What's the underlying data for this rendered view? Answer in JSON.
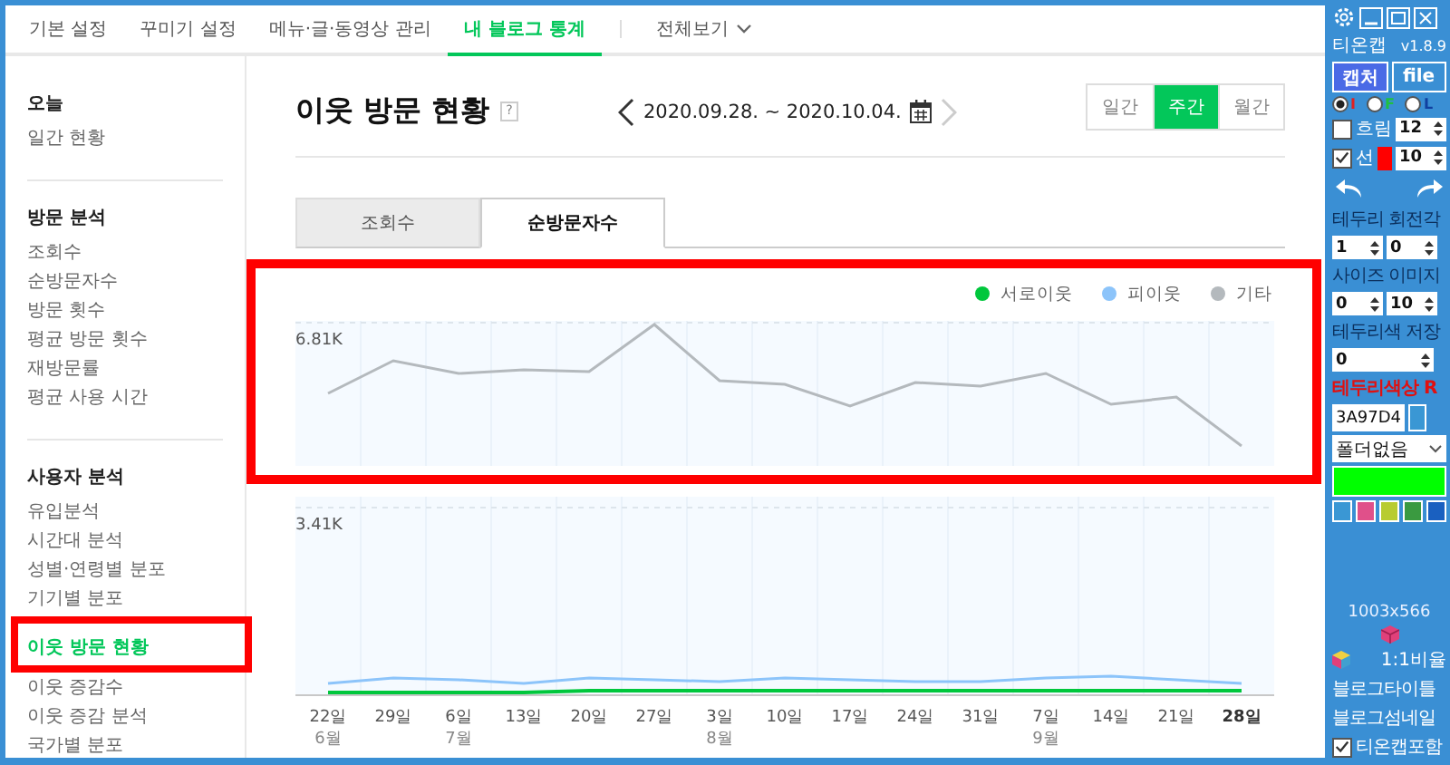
{
  "nav": {
    "tabs": [
      {
        "label": "기본 설정",
        "selected": false
      },
      {
        "label": "꾸미기 설정",
        "selected": false
      },
      {
        "label": "메뉴·글·동영상 관리",
        "selected": false
      },
      {
        "label": "내 블로그 통계",
        "selected": true
      }
    ],
    "more": "전체보기"
  },
  "sidebar": {
    "sections": [
      {
        "title": "오늘",
        "items": [
          {
            "label": "일간 현황",
            "selected": false
          }
        ]
      },
      {
        "title": "방문 분석",
        "items": [
          {
            "label": "조회수",
            "selected": false
          },
          {
            "label": "순방문자수",
            "selected": false
          },
          {
            "label": "방문 횟수",
            "selected": false
          },
          {
            "label": "평균 방문 횟수",
            "selected": false
          },
          {
            "label": "재방문률",
            "selected": false
          },
          {
            "label": "평균 사용 시간",
            "selected": false
          }
        ]
      },
      {
        "title": "사용자 분석",
        "items": [
          {
            "label": "유입분석",
            "selected": false
          },
          {
            "label": "시간대 분석",
            "selected": false
          },
          {
            "label": "성별·연령별 분포",
            "selected": false
          },
          {
            "label": "기기별 분포",
            "selected": false
          },
          {
            "label": "이웃 방문 현황",
            "selected": true
          },
          {
            "label": "이웃 증감수",
            "selected": false
          },
          {
            "label": "이웃 증감 분석",
            "selected": false
          },
          {
            "label": "국가별 분포",
            "selected": false
          }
        ]
      }
    ]
  },
  "page": {
    "title": "이웃 방문 현황",
    "help": "?",
    "date_range": "2020.09.28. ~ 2020.10.04.",
    "periods": [
      {
        "label": "일간",
        "selected": false
      },
      {
        "label": "주간",
        "selected": true
      },
      {
        "label": "월간",
        "selected": false
      }
    ],
    "metric_tabs": [
      {
        "label": "조회수",
        "selected": false
      },
      {
        "label": "순방문자수",
        "selected": true
      }
    ],
    "legend": [
      {
        "label": "서로이웃",
        "color": "#00c73c"
      },
      {
        "label": "피이웃",
        "color": "#8cc4fa"
      },
      {
        "label": "기타",
        "color": "#b4b9bd"
      }
    ],
    "upper_chart": {
      "y_label": "6.81K"
    },
    "lower_chart": {
      "y_label": "3.41K"
    },
    "x_axis": [
      {
        "day": "22일",
        "month": "6월",
        "current": false
      },
      {
        "day": "29일",
        "current": false
      },
      {
        "day": "6일",
        "month": "7월",
        "current": false
      },
      {
        "day": "13일",
        "current": false
      },
      {
        "day": "20일",
        "current": false
      },
      {
        "day": "27일",
        "current": false
      },
      {
        "day": "3일",
        "month": "8월",
        "current": false
      },
      {
        "day": "10일",
        "current": false
      },
      {
        "day": "17일",
        "current": false
      },
      {
        "day": "24일",
        "current": false
      },
      {
        "day": "31일",
        "current": false
      },
      {
        "day": "7일",
        "month": "9월",
        "current": false
      },
      {
        "day": "14일",
        "current": false
      },
      {
        "day": "21일",
        "current": false
      },
      {
        "day": "28일",
        "current": true
      }
    ]
  },
  "tool_panel": {
    "title": "티온캡",
    "version": "v1.8.9",
    "buttons": [
      {
        "label": "캡처",
        "selected": true
      },
      {
        "label": "file",
        "selected": false
      }
    ],
    "modes": [
      {
        "label": "I",
        "selected": true,
        "color": "#e02020"
      },
      {
        "label": "F",
        "selected": false,
        "color": "#20c040"
      },
      {
        "label": "L",
        "selected": false,
        "color": "#1040a0"
      }
    ],
    "blur": {
      "label": "흐림",
      "checked": false,
      "value": "12"
    },
    "line": {
      "label": "선",
      "checked": true,
      "value": "10"
    },
    "border_rotation": {
      "label": "테두리 회전각",
      "values": [
        "1",
        "0"
      ]
    },
    "size_image": {
      "label": "사이즈 이미지",
      "values": [
        "0",
        "10"
      ]
    },
    "border_save": {
      "label": "테두리색 저장",
      "value": "0"
    },
    "border_color": {
      "label": "테두리색상",
      "suffix": "R",
      "value": "3A97D4"
    },
    "folder": "폴더없음",
    "swatches": [
      {
        "color": "#3a97d4"
      },
      {
        "color": "#e0508a"
      },
      {
        "color": "#b8cc30"
      },
      {
        "color": "#3a9a40"
      },
      {
        "color": "#1a60c0"
      }
    ],
    "dimensions": "1003x566",
    "ratio": "1:1비율",
    "options": [
      "블로그타이틀",
      "블로그섬네일"
    ],
    "include": {
      "label": "티온캡포함",
      "checked": true
    }
  }
}
